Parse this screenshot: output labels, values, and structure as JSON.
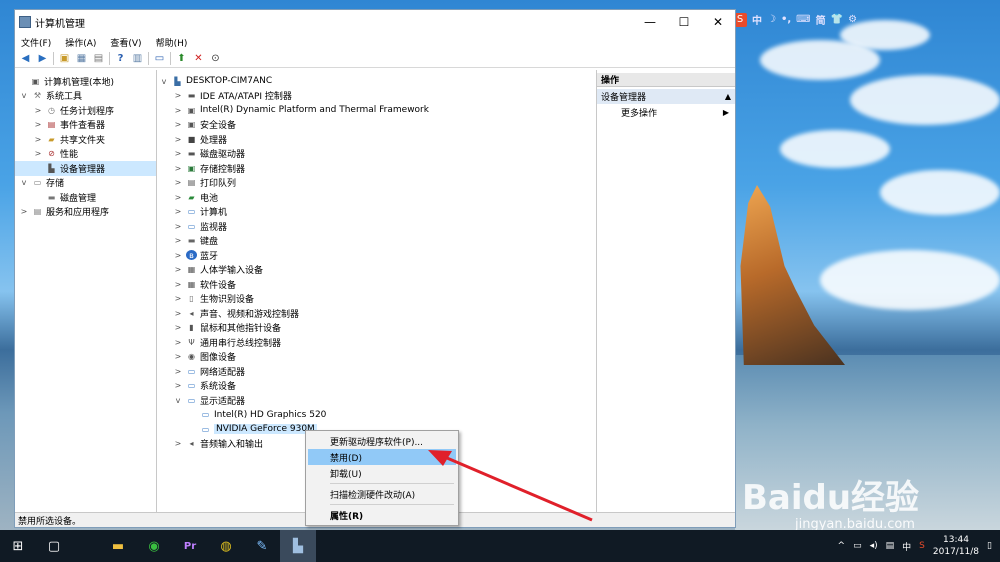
{
  "window": {
    "title": "计算机管理",
    "menu": [
      "文件(F)",
      "操作(A)",
      "查看(V)",
      "帮助(H)"
    ]
  },
  "left_tree": [
    {
      "label": "计算机管理(本地)",
      "level": 0,
      "twisty": "",
      "icon": "computer-manage-icon"
    },
    {
      "label": "系统工具",
      "level": 1,
      "twisty": "v",
      "icon": "tools-icon"
    },
    {
      "label": "任务计划程序",
      "level": 2,
      "twisty": ">",
      "icon": "clock-icon"
    },
    {
      "label": "事件查看器",
      "level": 2,
      "twisty": ">",
      "icon": "event-viewer-icon"
    },
    {
      "label": "共享文件夹",
      "level": 2,
      "twisty": ">",
      "icon": "shared-folder-icon"
    },
    {
      "label": "性能",
      "level": 2,
      "twisty": ">",
      "icon": "performance-icon"
    },
    {
      "label": "设备管理器",
      "level": 2,
      "twisty": "",
      "icon": "device-manager-icon",
      "selected": true
    },
    {
      "label": "存储",
      "level": 1,
      "twisty": "v",
      "icon": "storage-icon"
    },
    {
      "label": "磁盘管理",
      "level": 2,
      "twisty": "",
      "icon": "disk-icon"
    },
    {
      "label": "服务和应用程序",
      "level": 1,
      "twisty": ">",
      "icon": "services-icon"
    }
  ],
  "device_tree": {
    "root": "DESKTOP-CIM7ANC",
    "items": [
      {
        "label": "IDE ATA/ATAPI 控制器",
        "level": 1,
        "twisty": ">",
        "icon": "ide-controller-icon"
      },
      {
        "label": "Intel(R) Dynamic Platform and Thermal Framework",
        "level": 1,
        "twisty": ">",
        "icon": "thermal-icon"
      },
      {
        "label": "安全设备",
        "level": 1,
        "twisty": ">",
        "icon": "security-device-icon"
      },
      {
        "label": "处理器",
        "level": 1,
        "twisty": ">",
        "icon": "processor-icon"
      },
      {
        "label": "磁盘驱动器",
        "level": 1,
        "twisty": ">",
        "icon": "disk-drive-icon"
      },
      {
        "label": "存储控制器",
        "level": 1,
        "twisty": ">",
        "icon": "storage-controller-icon"
      },
      {
        "label": "打印队列",
        "level": 1,
        "twisty": ">",
        "icon": "printer-icon"
      },
      {
        "label": "电池",
        "level": 1,
        "twisty": ">",
        "icon": "battery-icon"
      },
      {
        "label": "计算机",
        "level": 1,
        "twisty": ">",
        "icon": "computer-icon"
      },
      {
        "label": "监视器",
        "level": 1,
        "twisty": ">",
        "icon": "monitor-icon"
      },
      {
        "label": "键盘",
        "level": 1,
        "twisty": ">",
        "icon": "keyboard-icon"
      },
      {
        "label": "蓝牙",
        "level": 1,
        "twisty": ">",
        "icon": "bluetooth-icon"
      },
      {
        "label": "人体学输入设备",
        "level": 1,
        "twisty": ">",
        "icon": "hid-icon"
      },
      {
        "label": "软件设备",
        "level": 1,
        "twisty": ">",
        "icon": "software-device-icon"
      },
      {
        "label": "生物识别设备",
        "level": 1,
        "twisty": ">",
        "icon": "biometric-icon"
      },
      {
        "label": "声音、视频和游戏控制器",
        "level": 1,
        "twisty": ">",
        "icon": "sound-icon"
      },
      {
        "label": "鼠标和其他指针设备",
        "level": 1,
        "twisty": ">",
        "icon": "mouse-icon"
      },
      {
        "label": "通用串行总线控制器",
        "level": 1,
        "twisty": ">",
        "icon": "usb-icon"
      },
      {
        "label": "图像设备",
        "level": 1,
        "twisty": ">",
        "icon": "camera-icon"
      },
      {
        "label": "网络适配器",
        "level": 1,
        "twisty": ">",
        "icon": "network-adapter-icon"
      },
      {
        "label": "系统设备",
        "level": 1,
        "twisty": ">",
        "icon": "system-device-icon"
      },
      {
        "label": "显示适配器",
        "level": 1,
        "twisty": "v",
        "icon": "display-adapter-icon"
      },
      {
        "label": "Intel(R) HD Graphics 520",
        "level": 2,
        "twisty": "",
        "icon": "display-adapter-icon"
      },
      {
        "label": "NVIDIA GeForce 930M",
        "level": 2,
        "twisty": "",
        "icon": "display-adapter-icon",
        "selected": true
      },
      {
        "label": "音频输入和输出",
        "level": 1,
        "twisty": ">",
        "icon": "audio-io-icon"
      }
    ]
  },
  "actions": {
    "header": "操作",
    "section": "设备管理器",
    "more": "更多操作"
  },
  "context_menu": {
    "update_driver": "更新驱动程序软件(P)...",
    "disable": "禁用(D)",
    "uninstall": "卸载(U)",
    "scan": "扫描检测硬件改动(A)",
    "properties": "属性(R)"
  },
  "status": "禁用所选设备。",
  "ime": {
    "items": [
      "中",
      "☽",
      "•,",
      "⌨",
      "简",
      "👕",
      "⚙"
    ]
  },
  "watermark": {
    "brand": "Baidu经验",
    "url": "jingyan.baidu.com"
  },
  "taskbar": {
    "time": "13:44",
    "date": "2017/11/8",
    "lang": "中"
  },
  "colors": {
    "selection": "#cce8ff",
    "menu_highlight": "#91c9f7",
    "arrow": "#e0202a"
  }
}
